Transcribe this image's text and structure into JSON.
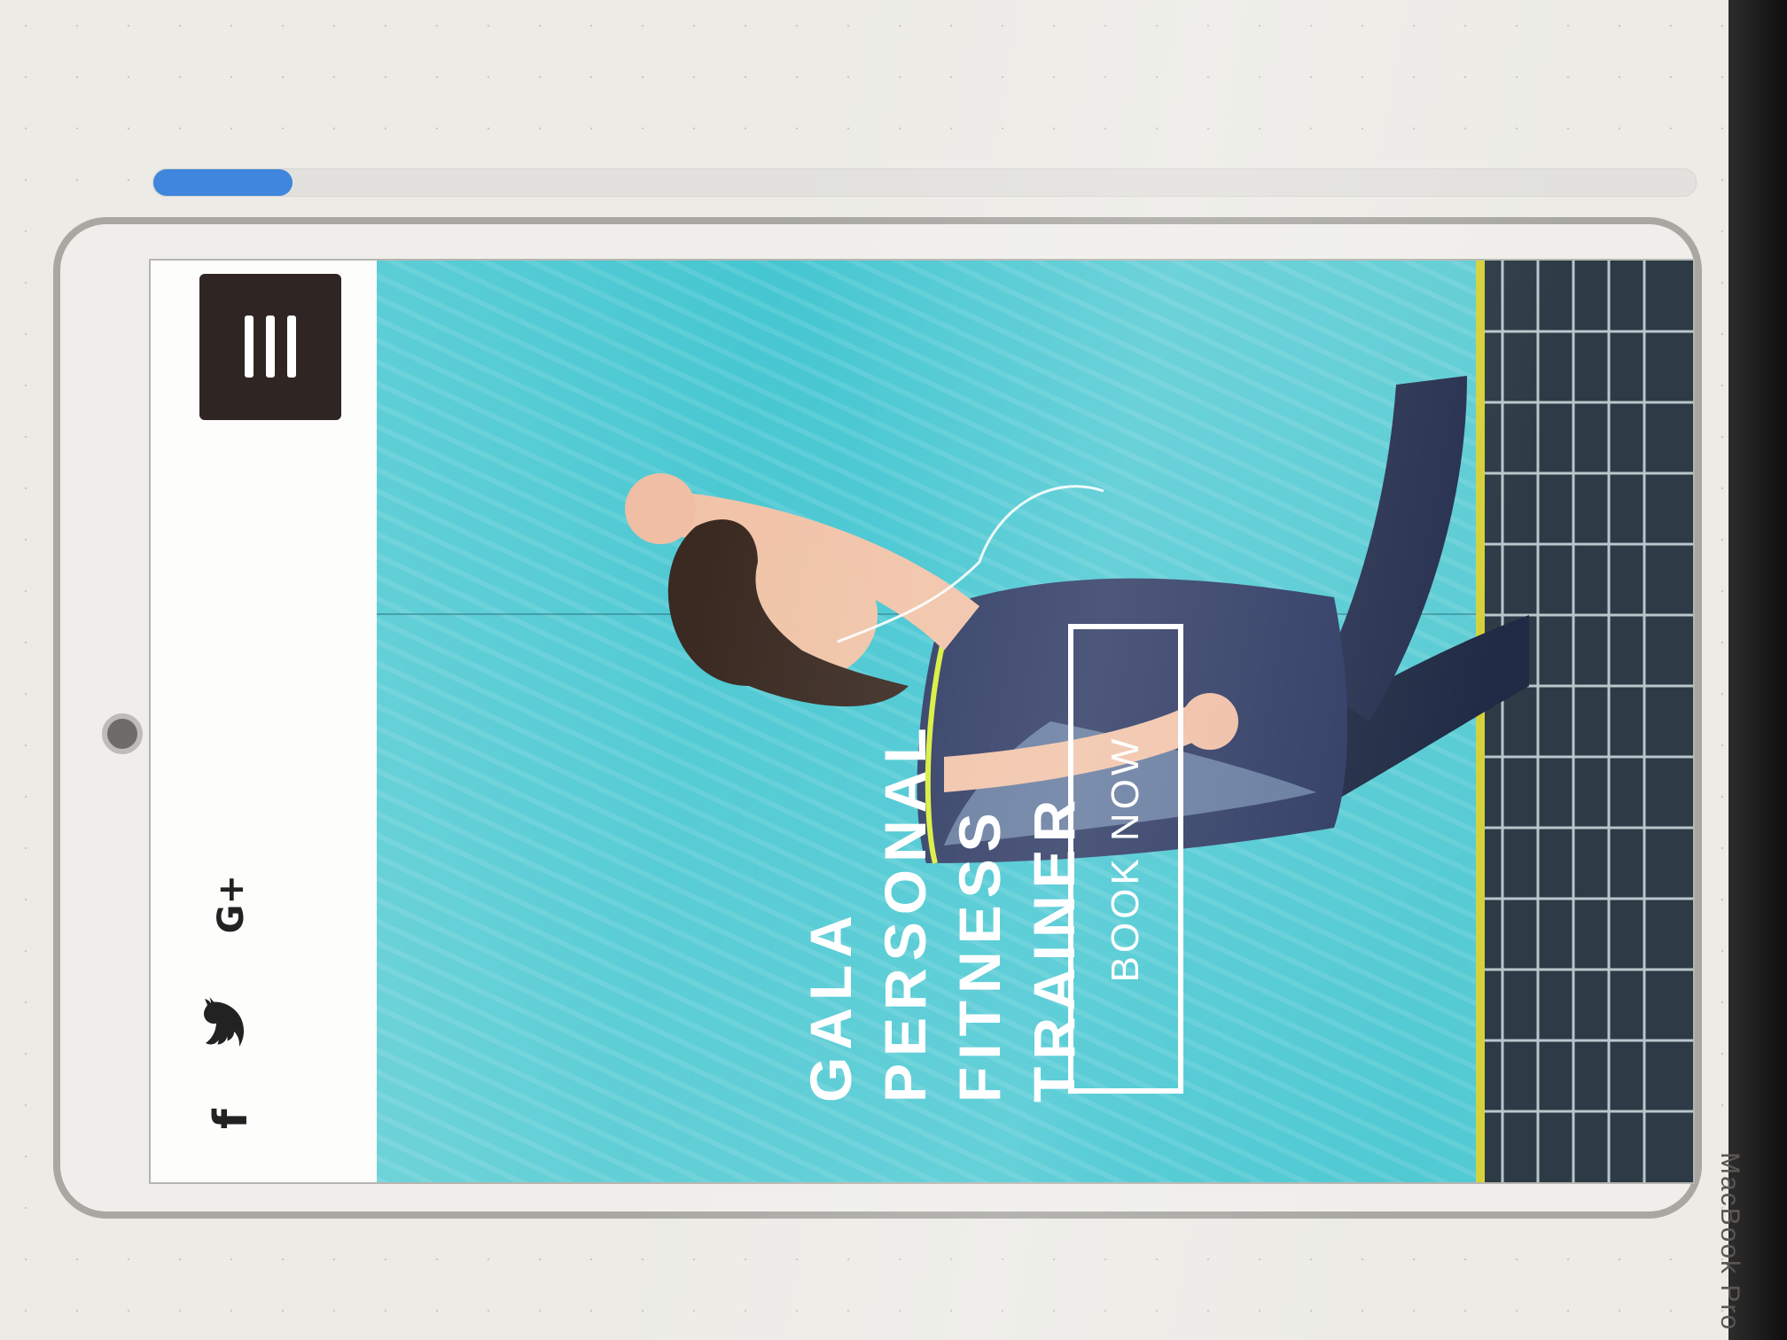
{
  "progress": {
    "fraction": 0.09
  },
  "device_page": {
    "social_icons": [
      "facebook-icon",
      "twitter-icon",
      "google-plus-icon"
    ],
    "social_glyphs": {
      "facebook": "f",
      "twitter": "ᴛ",
      "google_plus": "G+"
    },
    "menu_icon": "hamburger-icon",
    "hero": {
      "title_lines": [
        "GALA",
        "PERSONAL",
        "FITNESS",
        "TRAINER"
      ],
      "cta_label": "BOOK NOW"
    }
  },
  "bezel_text": "MacBook Pro",
  "colors": {
    "hero_bg": "#44c6d1",
    "menu_bg": "#2f2624",
    "progress": "#3f86dc",
    "accent_yellow": "#e8e23a"
  }
}
